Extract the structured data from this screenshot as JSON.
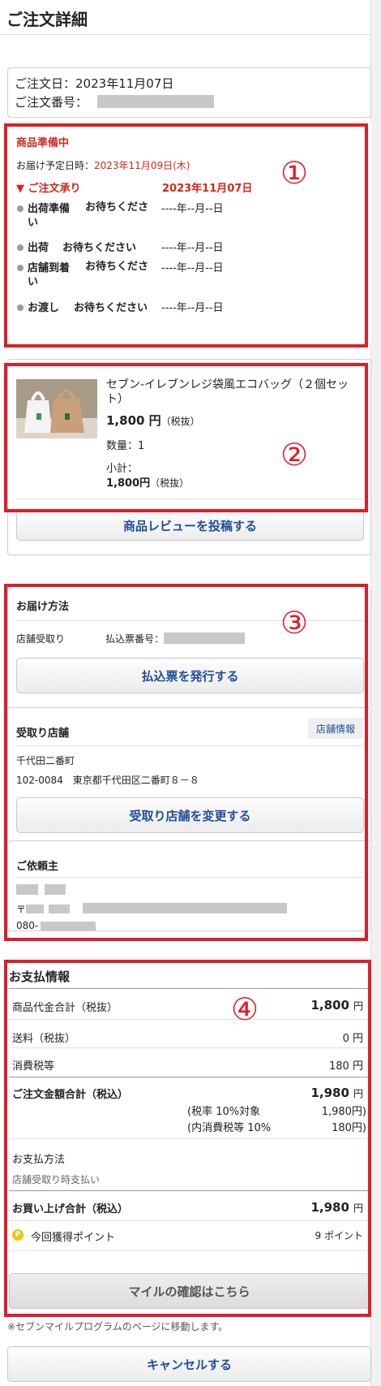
{
  "header": {
    "title": "ご注文詳細"
  },
  "order": {
    "date_label": "ご注文日：",
    "date_value": "2023年11月07日",
    "number_label": "ご注文番号："
  },
  "status": {
    "title": "商品準備中",
    "delivery_label": "お届け予定日時：",
    "delivery_date": "2023年11月09日(木)",
    "steps": [
      {
        "label": "ご注文承り",
        "date": "2023年11月07日"
      },
      {
        "label": "出荷準備",
        "status": "お待ちくださ",
        "status2": "い",
        "date": "----年--月--日"
      },
      {
        "label": "出荷",
        "status": "お待ちください",
        "date": "----年--月--日"
      },
      {
        "label": "店舗到着",
        "status": "お待ちくださ",
        "status2": "い",
        "date": "----年--月--日"
      },
      {
        "label": "お渡し",
        "status": "お待ちください",
        "date": "----年--月--日"
      }
    ]
  },
  "product": {
    "name": "セブン-イレブンレジ袋風エコバッグ（２個セット）",
    "price": "1,800 円",
    "tax_note": "（税抜）",
    "qty": "数量：1",
    "subtotal_label": "小計：",
    "subtotal_value": "1,800円",
    "review_button": "商品レビューを投稿する"
  },
  "delivery": {
    "method_title": "お届け方法",
    "method_value": "店舗受取り",
    "slip_label": "払込票番号：",
    "issue_button": "払込票を発行する",
    "store_title": "受取り店舗",
    "store_info_button": "店舗情報",
    "store_name": "千代田二番町",
    "store_address": "102-0084　東京都千代田区二番町８－８",
    "change_store_button": "受取り店舗を変更する",
    "client_title": "ご依頼主",
    "client_postal": "〒",
    "client_phone": "080-"
  },
  "payment": {
    "title": "お支払情報",
    "rows": [
      {
        "label": "商品代金合計（税抜）",
        "value": "1,800",
        "unit": "円"
      },
      {
        "label": "送料（税抜）",
        "value": "0",
        "unit": "円"
      },
      {
        "label": "消費税等",
        "value": "180",
        "unit": "円"
      }
    ],
    "total_label": "ご注文金額合計（税込）",
    "total_value": "1,980",
    "total_unit": "円",
    "tax_rate_label": "(税率 10%対象",
    "tax_rate_value": "1,980円)",
    "tax_inner_label": "(内消費税等 10%",
    "tax_inner_value": "180円)",
    "method_label": "お支払方法",
    "method_value": "店舗受取り時支払い",
    "purchase_label": "お買い上げ合計（税込）",
    "purchase_value": "1,980",
    "purchase_unit": "円",
    "points_label": "今回獲得ポイント",
    "points_value": "9 ポイント",
    "points_icon": "P",
    "mile_button": "マイルの確認はこちら",
    "mile_note": "※セブンマイルプログラムのページに移動します。"
  },
  "cancel_button": "キャンセルする",
  "annotations": [
    "①",
    "②",
    "③",
    "④"
  ],
  "colors": {
    "highlight_red": "#e01c2a",
    "status_red": "#d0281e",
    "link_blue": "#1f4e9b"
  }
}
